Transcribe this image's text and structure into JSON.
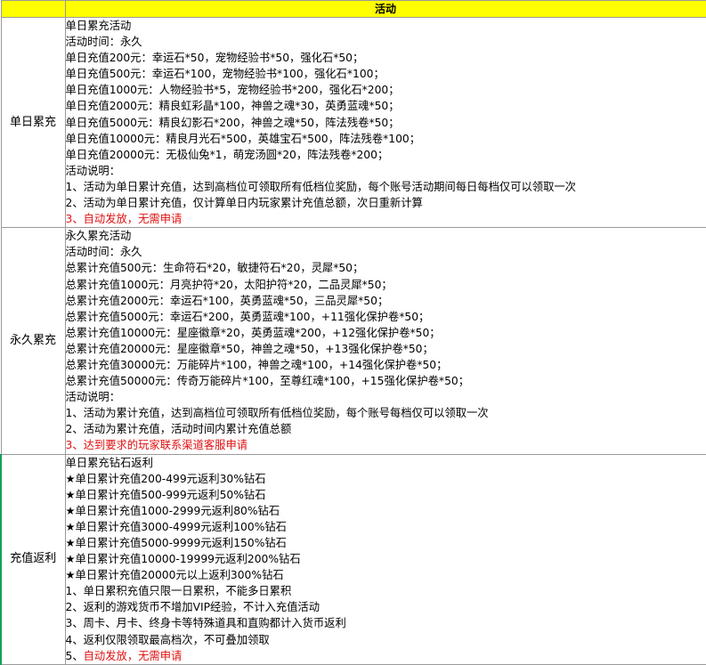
{
  "header": {
    "title": "活动"
  },
  "sections": [
    {
      "label": "单日累充",
      "lines": [
        {
          "text": "单日累充活动"
        },
        {
          "text": "活动时间：永久"
        },
        {
          "text": "单日充值200元：幸运石*50，宠物经验书*50，强化石*50；"
        },
        {
          "text": "单日充值500元：幸运石*100，宠物经验书*100，强化石*100；"
        },
        {
          "text": "单日充值1000元：人物经验书*5，宠物经验书*200，强化石*200；"
        },
        {
          "text": "单日充值2000元：精良虹彩晶*100，神兽之魂*30，英勇蓝魂*50；"
        },
        {
          "text": "单日充值5000元：精良幻影石*200，神兽之魂*50，阵法残卷*50；"
        },
        {
          "text": "单日充值10000元：精良月光石*500，英雄宝石*500，阵法残卷*100；"
        },
        {
          "text": "单日充值20000元：无极仙兔*1，萌宠汤圆*20，阵法残卷*200；"
        },
        {
          "text": "活动说明："
        },
        {
          "text": "1、活动为单日累计充值，达到高档位可领取所有低档位奖励，每个账号活动期间每日每档仅可以领取一次"
        },
        {
          "text": "2、活动为单日累计充值，仅计算单日内玩家累计充值总额，次日重新计算"
        },
        {
          "text": "3、自动发放，无需申请",
          "red": true
        }
      ]
    },
    {
      "label": "永久累充",
      "lines": [
        {
          "text": "永久累充活动"
        },
        {
          "text": "活动时间：永久"
        },
        {
          "text": "总累计充值500元：生命符石*20，敏捷符石*20，灵犀*50；"
        },
        {
          "text": "总累计充值1000元：月亮护符*20，太阳护符*20，二品灵犀*50；"
        },
        {
          "text": "总累计充值2000元：幸运石*100，英勇蓝魂*50，三品灵犀*50；"
        },
        {
          "text": "总累计充值5000元：幸运石*200，英勇蓝魂*100，+11强化保护卷*50；"
        },
        {
          "text": "总累计充值10000元：星座徽章*20，英勇蓝魂*200，+12强化保护卷*50；"
        },
        {
          "text": "总累计充值20000元：星座徽章*50，神兽之魂*50，+13强化保护卷*50；"
        },
        {
          "text": "总累计充值30000元：万能碎片*100，神兽之魂*100，+14强化保护卷*50；"
        },
        {
          "text": "总累计充值50000元：传奇万能碎片*100，至尊红魂*100，+15强化保护卷*50；"
        },
        {
          "text": "活动说明："
        },
        {
          "text": "1、活动为累计充值，达到高档位可领取所有低档位奖励，每个账号每档仅可以领取一次"
        },
        {
          "text": "2、活动为累计充值，活动时间内累计充值总额"
        },
        {
          "text": "3、达到要求的玩家联系渠道客服申请",
          "red": true
        }
      ]
    },
    {
      "label": "充值返利",
      "lines": [
        {
          "text": "单日累充钻石返利"
        },
        {
          "text": "★单日累计充值200-499元返利30%钻石"
        },
        {
          "text": "★单日累计充值500-999元返利50%钻石"
        },
        {
          "text": "★单日累计充值1000-2999元返利80%钻石"
        },
        {
          "text": "★单日累计充值3000-4999元返利100%钻石"
        },
        {
          "text": "★单日累计充值5000-9999元返利150%钻石"
        },
        {
          "text": "★单日累计充值10000-19999元返利200%钻石"
        },
        {
          "text": "★单日累计充值20000元以上返利300%钻石"
        },
        {
          "text": "1、单日累积充值只限一日累积，不能多日累积"
        },
        {
          "text": "2、返利的游戏货币不增加VIP经验，不计入充值活动"
        },
        {
          "text": "3、周卡、月卡、终身卡等特殊道具和直购都计入货币返利"
        },
        {
          "text": "4、返利仅限领取最高档次，不可叠加领取"
        },
        {
          "prefix": "5、",
          "text": "自动发放，无需申请",
          "red": true
        }
      ]
    }
  ]
}
